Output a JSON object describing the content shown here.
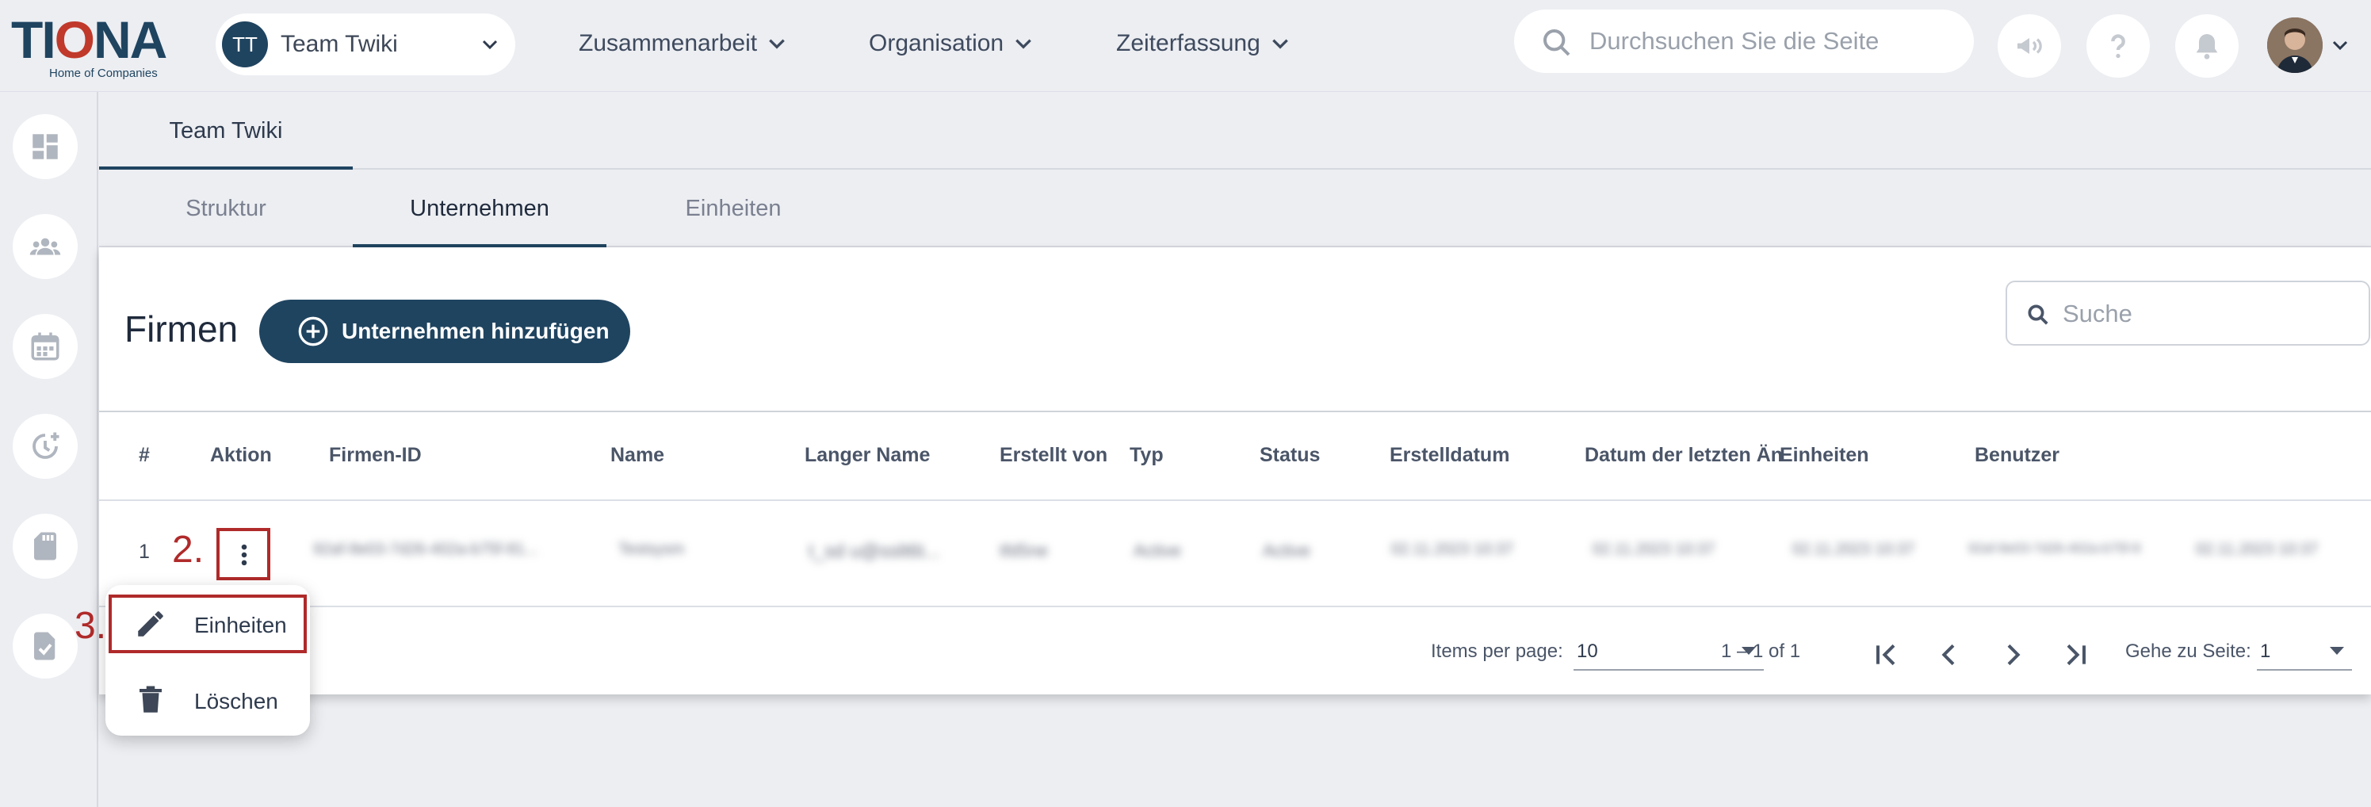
{
  "brand": {
    "logo_pre": "TI",
    "logo_o": "O",
    "logo_post": "NA",
    "tagline": "Home of Companies"
  },
  "team": {
    "initials": "TT",
    "name": "Team Twiki"
  },
  "nav": [
    {
      "label": "Zusammenarbeit"
    },
    {
      "label": "Organisation"
    },
    {
      "label": "Zeiterfassung"
    }
  ],
  "top_search": {
    "placeholder": "Durchsuchen Sie die Seite"
  },
  "tabs_primary": [
    {
      "label": "Team Twiki"
    }
  ],
  "tabs_secondary": [
    {
      "label": "Struktur"
    },
    {
      "label": "Unternehmen"
    },
    {
      "label": "Einheiten"
    }
  ],
  "card": {
    "title": "Firmen",
    "add_button": "Unternehmen hinzufügen",
    "search_placeholder": "Suche"
  },
  "table": {
    "columns": [
      "#",
      "Aktion",
      "Firmen-ID",
      "Name",
      "Langer Name",
      "Erstellt von",
      "Typ",
      "Status",
      "Erstelldatum",
      "Datum der letzten Än",
      "Einheiten",
      "Benutzer"
    ],
    "row": {
      "index": "1",
      "firmen_id": "92af-8e03-7d26-402a-b75f-81...",
      "name": "Testsysm",
      "langer_name": "t_sd u@sslt6t...",
      "erstellt_von": "tfd5ne",
      "typ": "Active",
      "status": "Active",
      "erstelldatum": "02.11.2023 10:37",
      "letzte_aenderung": "02.11.2023 10:37",
      "einheiten": "02.11.2023 10:37",
      "benutzer": "92af-8e03-7d26-402a-b75f-8",
      "extra": "02.11.2023 10:37"
    }
  },
  "annotations": {
    "step2": "2.",
    "step3": "3."
  },
  "menu": {
    "items": [
      {
        "label": "Einheiten"
      },
      {
        "label": "Löschen"
      }
    ]
  },
  "pager": {
    "items_per_page_label": "Items per page:",
    "items_per_page_value": "10",
    "range": "1 – 1 of 1",
    "goto_label": "Gehe zu Seite:",
    "goto_value": "1"
  },
  "colors": {
    "brand": "#1f4460",
    "accent_red": "#b02a2a",
    "background": "#eceef2"
  }
}
